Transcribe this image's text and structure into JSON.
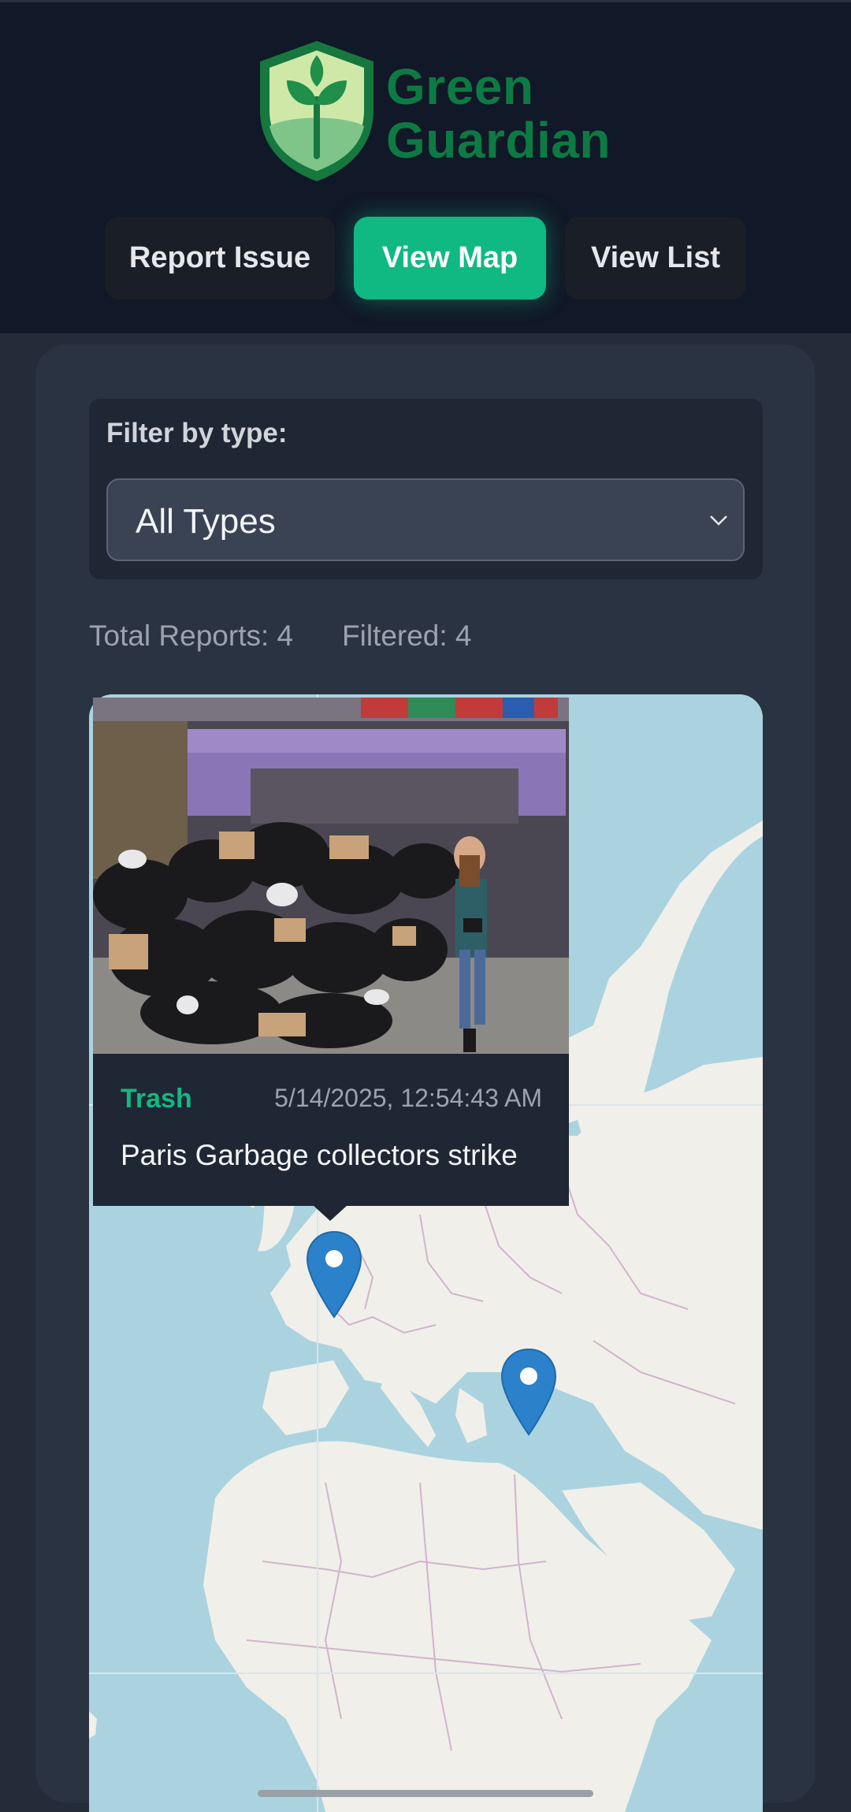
{
  "app": {
    "name_line1": "Green",
    "name_line2": "Guardian",
    "brand_color": "#0d7a43",
    "accent_color": "#10b981"
  },
  "nav": {
    "items": [
      {
        "label": "Report Issue",
        "active": false
      },
      {
        "label": "View Map",
        "active": true
      },
      {
        "label": "View List",
        "active": false
      }
    ]
  },
  "filter": {
    "label": "Filter by type:",
    "selected": "All Types",
    "chevron_icon": "chevron-down-icon"
  },
  "stats": {
    "total": "Total Reports: 4",
    "filtered": "Filtered: 4"
  },
  "map": {
    "zoom_in": "+",
    "zoom_out": "−",
    "popup": {
      "type": "Trash",
      "timestamp": "5/14/2025, 12:54:43 AM",
      "title": "Paris Garbage collectors strike"
    },
    "marker_count_visible": 2
  }
}
